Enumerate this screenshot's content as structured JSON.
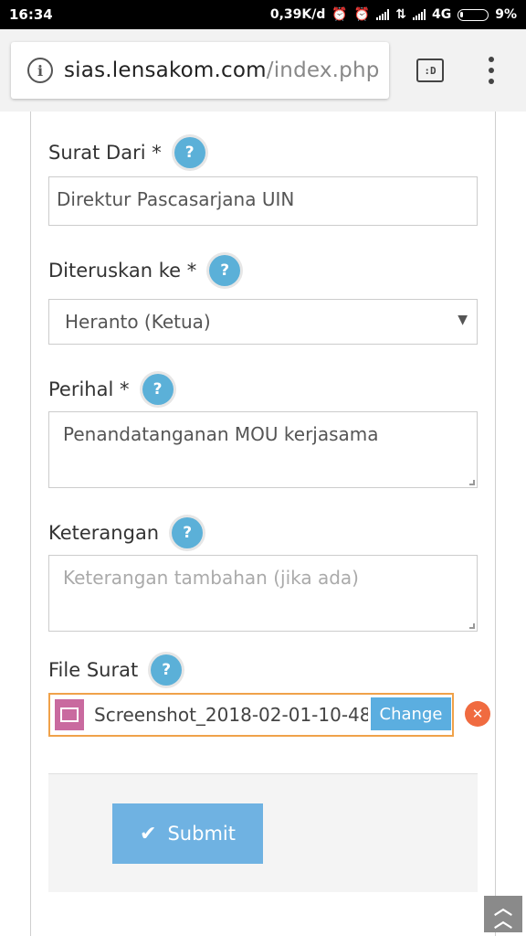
{
  "status_bar": {
    "time": "16:34",
    "network_speed": "0,39K/d",
    "network_type": "4G",
    "battery": "9%",
    "icons": [
      "alarm-off-icon",
      "alarm-icon",
      "signal-icon",
      "data-arrows-icon",
      "signal-icon",
      "battery-icon"
    ]
  },
  "browser": {
    "url_domain": "sias.lensakom.com",
    "url_path": "/index.php",
    "tabs_label": ":D"
  },
  "form": {
    "surat_dari": {
      "label": "Surat Dari *",
      "value": "Direktur Pascasarjana UIN"
    },
    "diteruskan_ke": {
      "label": "Diteruskan ke *",
      "value": "Heranto (Ketua)"
    },
    "perihal": {
      "label": "Perihal *",
      "value": "Penandatanganan MOU kerjasama"
    },
    "keterangan": {
      "label": "Keterangan",
      "placeholder": "Keterangan tambahan (jika ada)"
    },
    "file_surat": {
      "label": "File Surat",
      "file_name": "Screenshot_2018-02-01-10-48-",
      "change_label": "Change"
    },
    "help_symbol": "?",
    "submit_label": "Submit"
  },
  "colors": {
    "help_badge": "#5bb0d8",
    "submit_button": "#6fb2e2",
    "change_button": "#5baee0",
    "file_border": "#f0a24a",
    "remove_button": "#f06b40"
  }
}
